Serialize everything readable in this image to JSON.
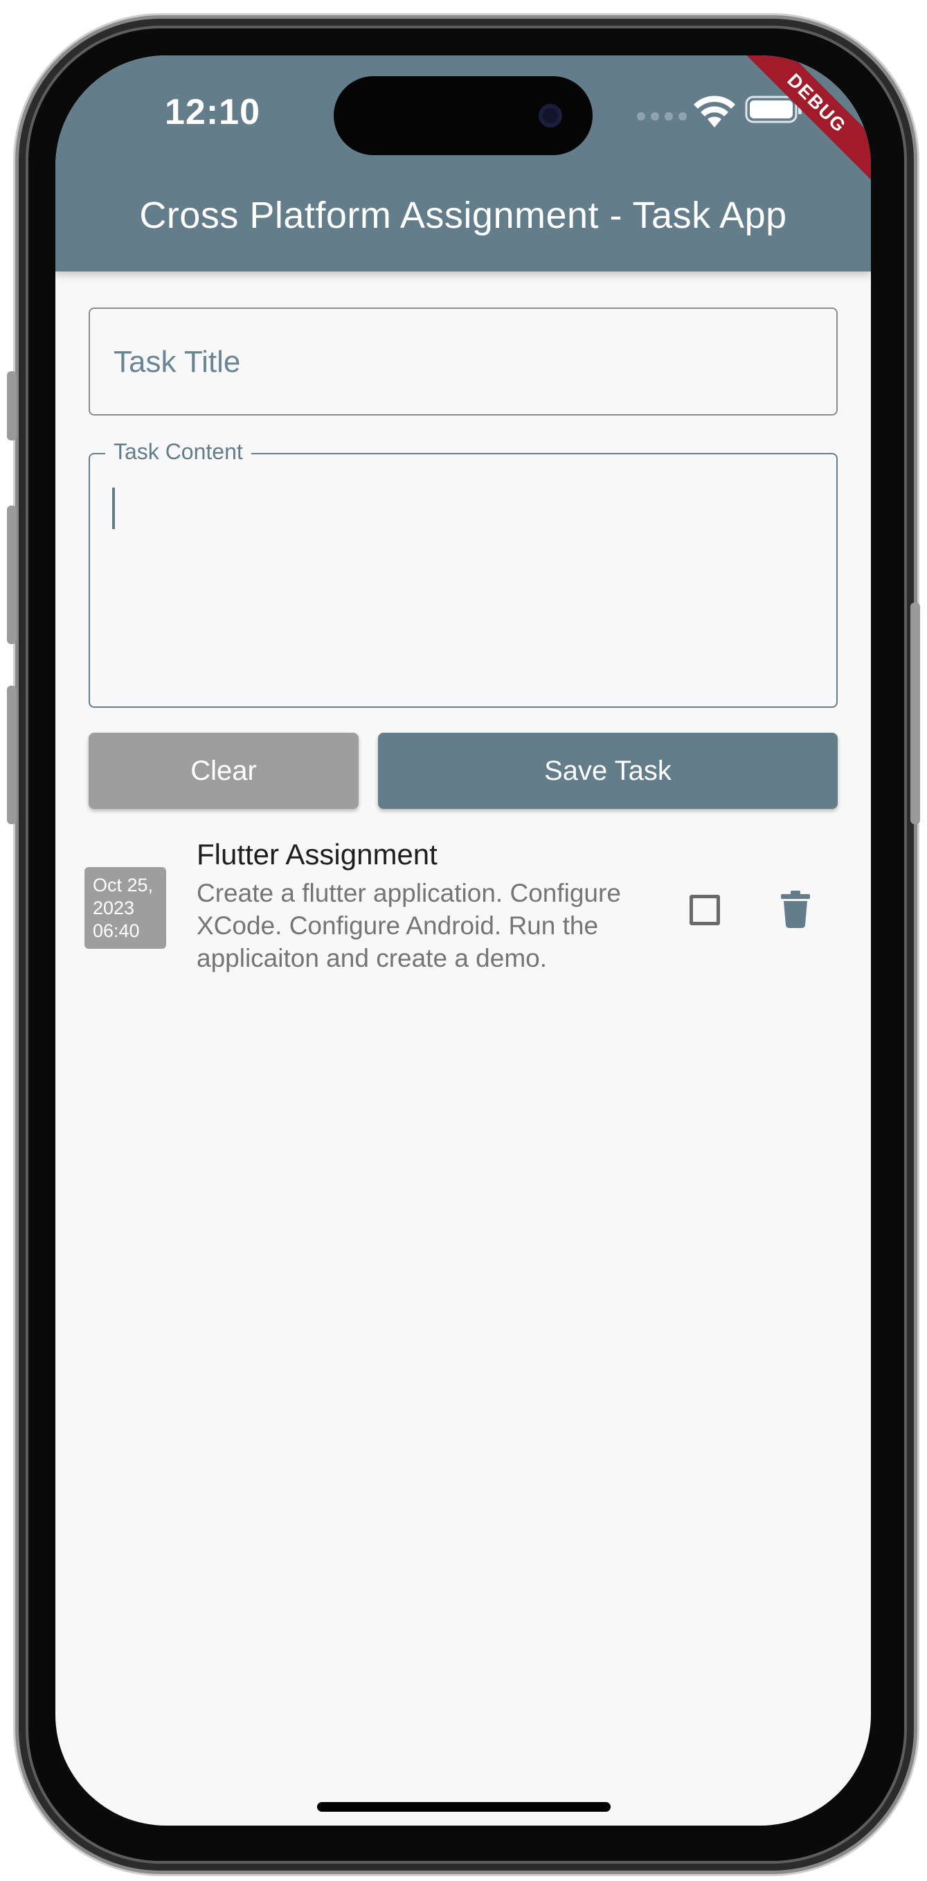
{
  "status_bar": {
    "time": "12:10",
    "debug_label": "DEBUG"
  },
  "app_bar": {
    "title": "Cross Platform Assignment - Task App",
    "color": "#637d8b"
  },
  "form": {
    "title_placeholder": "Task Title",
    "content_label": "Task Content",
    "content_value": "",
    "clear_label": "Clear",
    "save_label": "Save Task"
  },
  "tasks": [
    {
      "date_line1": "Oct 25,",
      "date_line2": "2023",
      "date_line3": "06:40",
      "title": "Flutter Assignment",
      "description": "Create a flutter application. Configure XCode. Configure Android. Run the applicaiton and create a demo.",
      "completed": false
    }
  ],
  "icons": {
    "wifi": "wifi-icon",
    "battery": "battery-icon",
    "checkbox": "checkbox-icon",
    "delete": "trash-icon"
  }
}
